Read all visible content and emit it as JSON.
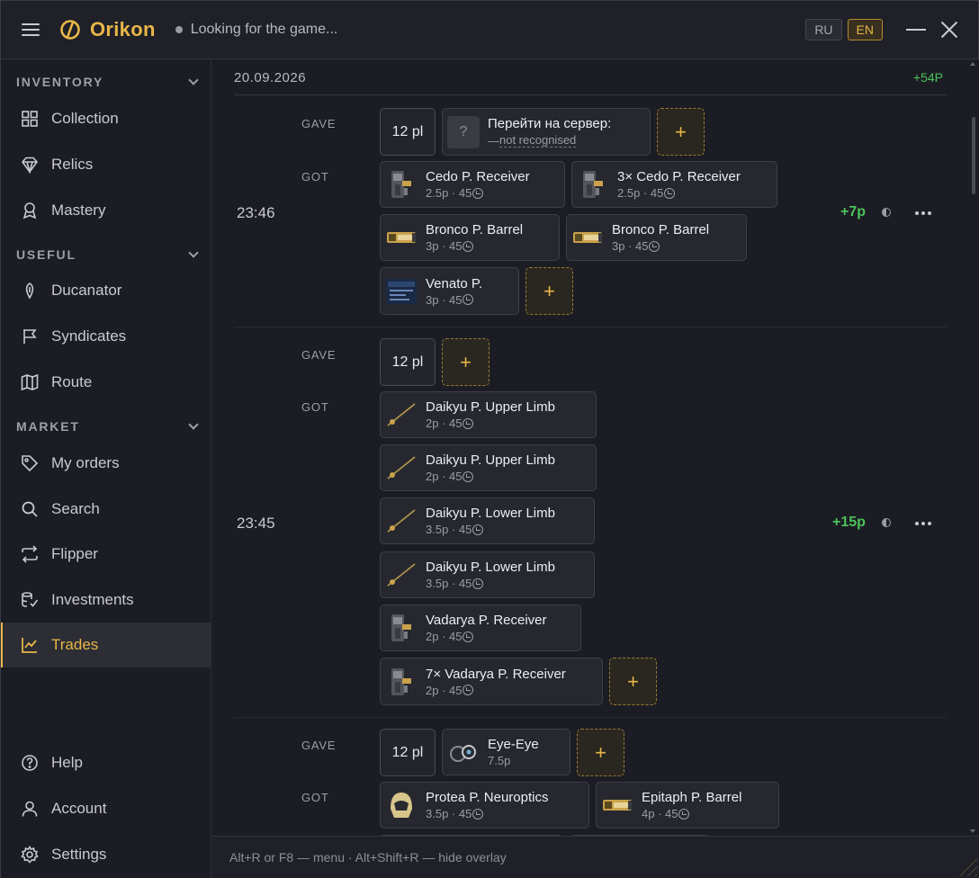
{
  "app": {
    "brand": "Orikon",
    "status": "Looking for the game..."
  },
  "lang": {
    "ru": "RU",
    "en": "EN"
  },
  "sidebar": {
    "inventory_title": "INVENTORY",
    "useful_title": "USEFUL",
    "market_title": "MARKET",
    "collection": "Collection",
    "relics": "Relics",
    "mastery": "Mastery",
    "ducanator": "Ducanator",
    "syndicates": "Syndicates",
    "route": "Route",
    "my_orders": "My orders",
    "search": "Search",
    "flipper": "Flipper",
    "investments": "Investments",
    "trades": "Trades",
    "help": "Help",
    "account": "Account",
    "settings": "Settings"
  },
  "labels": {
    "gave": "GAVE",
    "got": "GOT",
    "add": "+"
  },
  "day": {
    "date": "20.09.2026",
    "total": "+54P"
  },
  "trades": [
    {
      "time": "23:46",
      "profit": "+7p",
      "gave": {
        "plat": "12 pl",
        "server": {
          "name": "Перейти на сервер:",
          "dash": "— ",
          "status": "not recognised",
          "q": "?"
        }
      },
      "got": [
        {
          "name": "Cedo P. Receiver",
          "meta": "2.5p · 45"
        },
        {
          "name": "3× Cedo P. Receiver",
          "meta": "2.5p · 45"
        },
        {
          "name": "Bronco P. Barrel",
          "meta": "3p · 45"
        },
        {
          "name": "Bronco P. Barrel",
          "meta": "3p · 45"
        },
        {
          "name": "Venato P.",
          "meta": "3p · 45"
        }
      ]
    },
    {
      "time": "23:45",
      "profit": "+15p",
      "gave": {
        "plat": "12 pl"
      },
      "got": [
        {
          "name": "Daikyu P. Upper Limb",
          "meta": "2p · 45"
        },
        {
          "name": "Daikyu P. Upper Limb",
          "meta": "2p · 45"
        },
        {
          "name": "Daikyu P. Lower Limb",
          "meta": "3.5p · 45"
        },
        {
          "name": "Daikyu P. Lower Limb",
          "meta": "3.5p · 45"
        },
        {
          "name": "Vadarya P. Receiver",
          "meta": "2p · 45"
        },
        {
          "name": "7× Vadarya P. Receiver",
          "meta": "2p · 45"
        }
      ]
    },
    {
      "gave": {
        "plat": "12 pl",
        "item": {
          "name": "Eye-Eye",
          "meta": "7.5p"
        }
      },
      "got": [
        {
          "name": "Protea P. Neuroptics",
          "meta": "3.5p · 45"
        },
        {
          "name": "Epitaph P. Barrel",
          "meta": "4p · 45"
        }
      ]
    }
  ],
  "footer": {
    "hint": "Alt+R or F8 — menu · Alt+Shift+R — hide overlay"
  },
  "colors": {
    "accent": "#e8b648",
    "profit": "#4cc35a",
    "background": "#1c1d24"
  }
}
